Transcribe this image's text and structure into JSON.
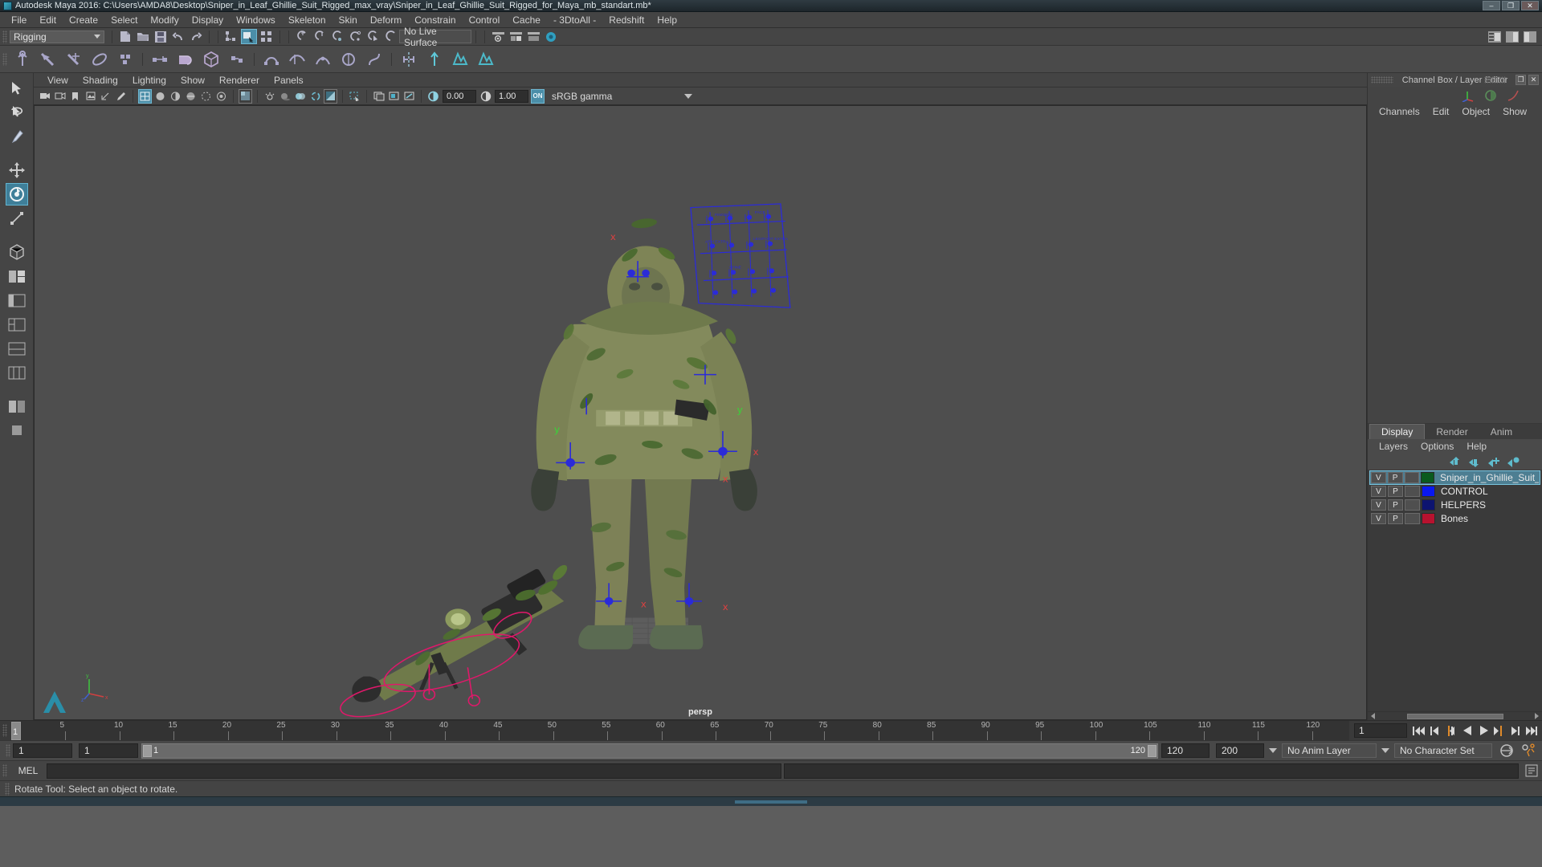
{
  "window": {
    "title": "Autodesk Maya 2016: C:\\Users\\AMDA8\\Desktop\\Sniper_in_Leaf_Ghillie_Suit_Rigged_max_vray\\Sniper_in_Leaf_Ghillie_Suit_Rigged_for_Maya_mb_standart.mb*",
    "minimize": "–",
    "maximize": "❐",
    "close": "✕"
  },
  "menubar": {
    "items": [
      "File",
      "Edit",
      "Create",
      "Select",
      "Modify",
      "Display",
      "Windows",
      "Skeleton",
      "Skin",
      "Deform",
      "Constrain",
      "Control",
      "Cache",
      "- 3DtoAll -",
      "Redshift",
      "Help"
    ]
  },
  "toolbar": {
    "menuset": "Rigging",
    "live_surface": "No Live Surface"
  },
  "viewport_panel": {
    "menu": [
      "View",
      "Shading",
      "Lighting",
      "Show",
      "Renderer",
      "Panels"
    ],
    "exposure_value": "0.00",
    "gamma_value": "1.00",
    "color_transform_toggle": "ON",
    "color_transform": "sRGB gamma",
    "camera_label": "persp",
    "axis": {
      "x": "x",
      "y": "y",
      "z": "z"
    }
  },
  "channel_box": {
    "panel_title": "Channel Box / Layer Editor",
    "menu": [
      "Channels",
      "Edit",
      "Object",
      "Show"
    ],
    "undock_glyph": "❐",
    "close_glyph": "✕"
  },
  "layer_editor": {
    "tabs": [
      {
        "label": "Display",
        "selected": true
      },
      {
        "label": "Render",
        "selected": false
      },
      {
        "label": "Anim",
        "selected": false
      }
    ],
    "menu": [
      "Layers",
      "Options",
      "Help"
    ],
    "col_visible": "V",
    "col_playback": "P",
    "layers": [
      {
        "name": "Sniper_in_Ghillie_Suit_",
        "v": "V",
        "p": "P",
        "type": "",
        "color": "#0a5a1e",
        "selected": true
      },
      {
        "name": "CONTROL",
        "v": "V",
        "p": "P",
        "type": "",
        "color": "#0a18f0",
        "selected": false
      },
      {
        "name": "HELPERS",
        "v": "V",
        "p": "P",
        "type": "",
        "color": "#0d1470",
        "selected": false
      },
      {
        "name": "Bones",
        "v": "V",
        "p": "P",
        "type": "",
        "color": "#b8122f",
        "selected": false
      }
    ]
  },
  "timeline": {
    "current_frame": "1",
    "start_frame": "1",
    "ticks": [
      5,
      10,
      15,
      20,
      25,
      30,
      35,
      40,
      45,
      50,
      55,
      60,
      65,
      70,
      75,
      80,
      85,
      90,
      95,
      100,
      105,
      110,
      115,
      120
    ],
    "frame_field": "1"
  },
  "range": {
    "anim_start": "1",
    "range_start": "1",
    "bar_start": "1",
    "bar_end": "120",
    "range_end": "120",
    "anim_end": "200",
    "anim_layer": "No Anim Layer",
    "character_set": "No Character Set"
  },
  "command_line": {
    "language": "MEL",
    "input_value": "",
    "result_value": ""
  },
  "status_bar": {
    "message": "Rotate Tool: Select an object to rotate."
  },
  "colors": {
    "accent_blue": "#4b8ea8",
    "panel_bg": "#444444",
    "viewport_bg": "#4e4e4e",
    "control_curve": "#2b2bd8",
    "bone_curve": "#e0186a",
    "axis_x": "#d04040",
    "axis_y": "#3fbf3f",
    "axis_z": "#4060d0"
  }
}
